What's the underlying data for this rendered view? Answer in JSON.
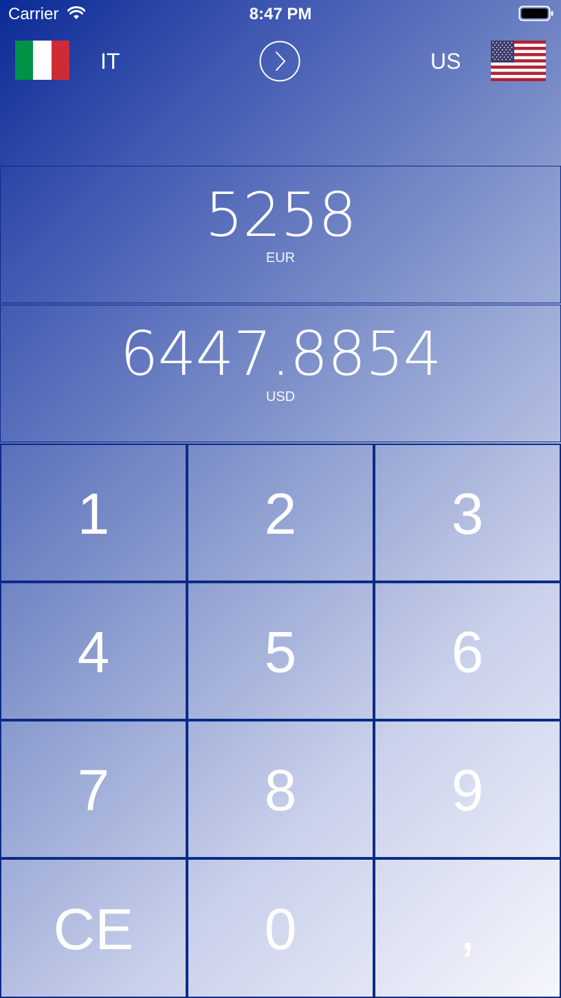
{
  "status_bar": {
    "carrier": "Carrier",
    "time": "8:47 PM",
    "icons": [
      "wifi-icon",
      "battery-icon"
    ]
  },
  "header": {
    "from_code": "IT",
    "to_code": "US",
    "from_flag": "italy-flag-icon",
    "to_flag": "usa-flag-icon",
    "swap_icon": "chevron-right-circle-icon"
  },
  "display": {
    "from_amount": "5258",
    "from_currency": "EUR",
    "to_amount": "6447.8854",
    "to_currency": "USD"
  },
  "keypad": {
    "keys": [
      "1",
      "2",
      "3",
      "4",
      "5",
      "6",
      "7",
      "8",
      "9",
      "CE",
      "0",
      ","
    ]
  },
  "colors": {
    "gradient_start": "#0a2a96",
    "gradient_end": "#f6f7fc",
    "grid_lines": "#0b2a88",
    "text": "#ffffff",
    "italy_green": "#009246",
    "italy_white": "#ffffff",
    "italy_red": "#ce2b37",
    "usa_red": "#b22234",
    "usa_blue": "#3c3b6e"
  }
}
